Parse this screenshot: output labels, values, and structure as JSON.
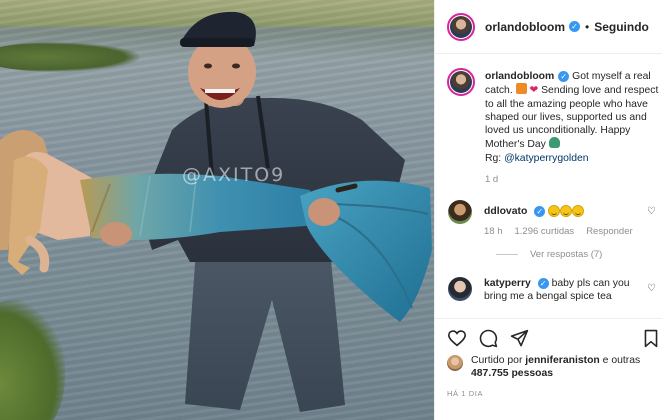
{
  "post": {
    "watermark": "@AXITO9"
  },
  "header": {
    "username": "orlandobloom",
    "separator": "•",
    "follow_status": "Seguindo"
  },
  "caption": {
    "username": "orlandobloom",
    "text_1": " Got myself a real catch. ",
    "text_2": " Sending love and respect to all the amazing people who have shaped our lives, supported us and loved us unconditionally. Happy Mother's Day ",
    "credit_prefix": "Rg: ",
    "mention": "@katyperrygolden",
    "time": "1 d"
  },
  "comments": [
    {
      "username": "ddlovato",
      "time": "18 h",
      "likes": "1.296 curtidas",
      "reply_label": "Responder",
      "view_replies": "Ver respostas (7)"
    },
    {
      "username": "katyperry",
      "text": " baby pls can you bring me a bengal spice tea"
    }
  ],
  "likes": {
    "prefix": "Curtido por ",
    "user": "jenniferaniston",
    "middle": " e outras ",
    "count": "487.755 pessoas"
  },
  "timestamp": "HÁ 1 DIA",
  "icons": {
    "verified": "verified-badge-icon",
    "heart": "heart-icon",
    "comment": "comment-icon",
    "share": "share-icon",
    "save": "bookmark-icon"
  },
  "colors": {
    "verified": "#3897f0",
    "mention": "#00376b",
    "muted": "#8e8e8e",
    "story_ring": "#d6249f"
  }
}
